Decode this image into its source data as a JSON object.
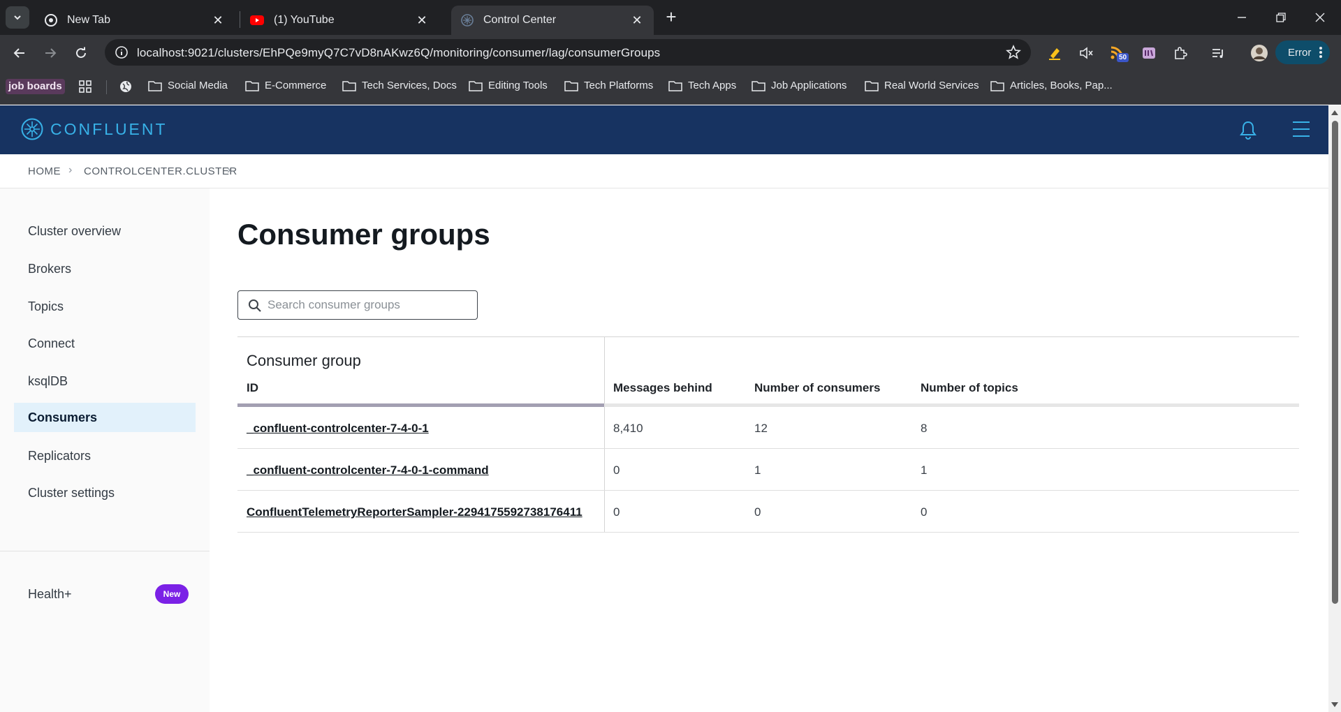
{
  "browser": {
    "tabs": [
      {
        "title": "New Tab",
        "icon": "chrome-icon"
      },
      {
        "title": "(1) YouTube",
        "icon": "youtube-icon"
      },
      {
        "title": "Control Center",
        "icon": "confluent-icon"
      }
    ],
    "url": "localhost:9021/clusters/EhPQe9myQ7C7vD8nAKwz6Q/monitoring/consumer/lag/consumerGroups",
    "extension_badge": "50",
    "error_label": "Error",
    "bookmarks": {
      "job_boards": "job boards",
      "folders": [
        "Social Media",
        "E-Commerce",
        "Tech Services, Docs",
        "Editing Tools",
        "Tech Platforms",
        "Tech Apps",
        "Job Applications",
        "Real World Services",
        "Articles, Books, Pap..."
      ]
    }
  },
  "app": {
    "brand": "CONFLUENT",
    "breadcrumb": [
      "HOME",
      "CONTROLCENTER.CLUSTER"
    ],
    "sidebar": {
      "items": [
        "Cluster overview",
        "Brokers",
        "Topics",
        "Connect",
        "ksqlDB",
        "Consumers",
        "Replicators",
        "Cluster settings"
      ],
      "active": "Consumers",
      "health_label": "Health+",
      "health_badge": "New"
    },
    "page_title": "Consumer groups",
    "search_placeholder": "Search consumer groups",
    "table": {
      "group_header": "Consumer group",
      "columns": [
        "ID",
        "Messages behind",
        "Number of consumers",
        "Number of topics"
      ],
      "rows": [
        {
          "id": "_confluent-controlcenter-7-4-0-1",
          "messages_behind": "8,410",
          "consumers": "12",
          "topics": "8"
        },
        {
          "id": "_confluent-controlcenter-7-4-0-1-command",
          "messages_behind": "0",
          "consumers": "1",
          "topics": "1"
        },
        {
          "id": "ConfluentTelemetryReporterSampler-2294175592738176411",
          "messages_behind": "0",
          "consumers": "0",
          "topics": "0"
        }
      ]
    }
  },
  "colors": {
    "header_bg": "#173361",
    "brand_accent": "#38b2e8",
    "active_nav_bg": "#e2f1fb",
    "new_badge": "#7b21e6"
  }
}
